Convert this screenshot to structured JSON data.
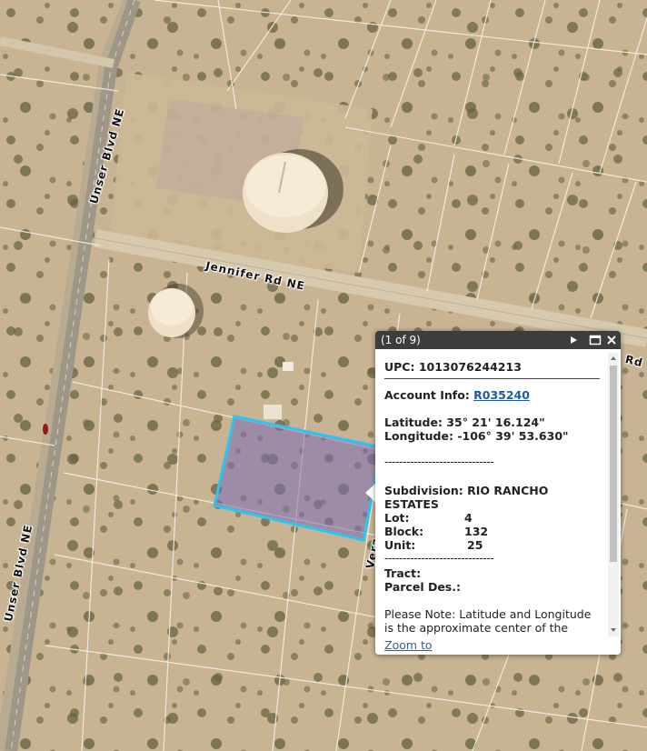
{
  "map": {
    "roads": {
      "unser_top": "Unser Blvd NE",
      "unser_bottom": "Unser Blvd NE",
      "jennifer": "Jennifer Rd NE",
      "right_edge_label": "Rd",
      "partial_label": "Vera"
    },
    "colors": {
      "terrain": "#c9b494",
      "parcel_outline": "#2bc5f2",
      "parcel_fill": "#7b6bb6"
    }
  },
  "popup": {
    "counter": "(1 of 9)",
    "buttons": {
      "next": "next-icon",
      "maximize": "maximize-icon",
      "close": "close-icon"
    },
    "upc": "UPC: 1013076244213",
    "account_label": "Account Info: ",
    "account_link": "R035240",
    "latitude": "Latitude: 35° 21' 16.124\"",
    "longitude": "Longitude: -106° 39' 53.630\"",
    "separator": "------------------------------",
    "subdivision_line1": "Subdivision: RIO RANCHO",
    "subdivision_line2": "ESTATES",
    "lot_label": "Lot:",
    "lot_value": "4",
    "block_label": "Block:",
    "block_value": "132",
    "unit_label": "Unit:",
    "unit_value": "25",
    "tract_label": "Tract:",
    "parcel_label": "Parcel Des.:",
    "note": "Please Note: Latitude and Longitude is the approximate center of the parcel shown.",
    "zoom_to": "Zoom to"
  }
}
